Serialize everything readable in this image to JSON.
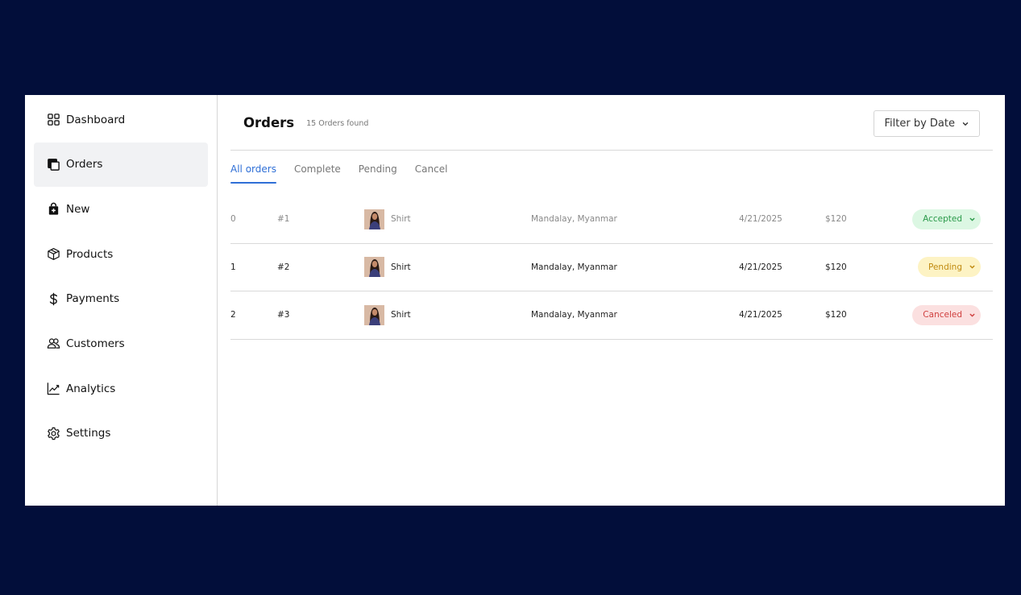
{
  "sidebar": {
    "items": [
      {
        "label": "Dashboard",
        "icon": "grid-icon"
      },
      {
        "label": "Orders",
        "icon": "orders-icon"
      },
      {
        "label": "New",
        "icon": "bag-icon"
      },
      {
        "label": "Products",
        "icon": "box-icon"
      },
      {
        "label": "Payments",
        "icon": "dollar-icon"
      },
      {
        "label": "Customers",
        "icon": "users-icon"
      },
      {
        "label": "Analytics",
        "icon": "chart-line-icon"
      },
      {
        "label": "Settings",
        "icon": "gear-icon"
      }
    ],
    "active_index": 1
  },
  "header": {
    "title": "Orders",
    "subtitle": "15 Orders found",
    "filter_label": "Filter by Date"
  },
  "tabs": [
    {
      "label": "All orders",
      "active": true
    },
    {
      "label": "Complete",
      "active": false
    },
    {
      "label": "Pending",
      "active": false
    },
    {
      "label": "Cancel",
      "active": false
    }
  ],
  "orders": [
    {
      "index": "0",
      "id": "#1",
      "product": "Shirt",
      "location": "Mandalay, Myanmar",
      "date": "4/21/2025",
      "price": "$120",
      "status": "Accepted"
    },
    {
      "index": "1",
      "id": "#2",
      "product": "Shirt",
      "location": "Mandalay, Myanmar",
      "date": "4/21/2025",
      "price": "$120",
      "status": "Pending"
    },
    {
      "index": "2",
      "id": "#3",
      "product": "Shirt",
      "location": "Mandalay, Myanmar",
      "date": "4/21/2025",
      "price": "$120",
      "status": "Canceled"
    }
  ],
  "colors": {
    "background": "#020e3a",
    "accent": "#2f6fd6",
    "accepted": "#2b9a4a",
    "pending": "#c08a10",
    "canceled": "#d0403f"
  }
}
